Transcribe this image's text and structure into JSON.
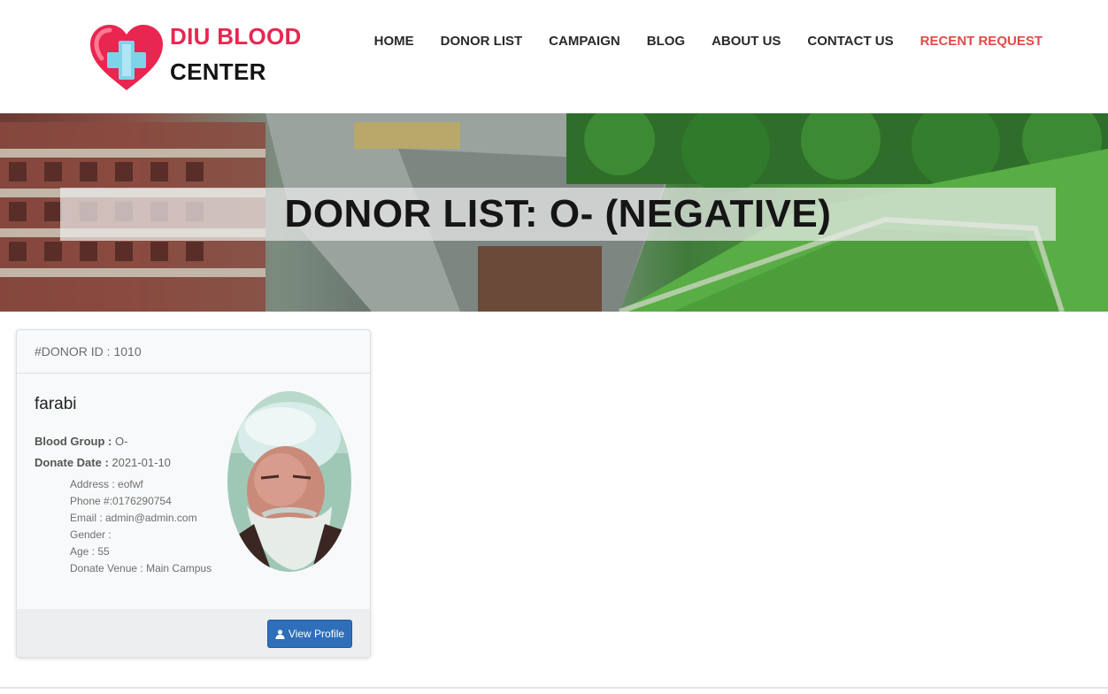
{
  "brand": {
    "line1": "DIU BLOOD",
    "line2": "CENTER",
    "logo_icon": "heart-plus-icon",
    "color_primary": "#e8264f"
  },
  "nav": {
    "items": [
      {
        "label": "HOME"
      },
      {
        "label": "DONOR LIST"
      },
      {
        "label": "CAMPAIGN"
      },
      {
        "label": "BLOG"
      },
      {
        "label": "ABOUT US"
      },
      {
        "label": "CONTACT US"
      },
      {
        "label": "RECENT REQUEST",
        "color": "#e14a4a"
      }
    ]
  },
  "banner": {
    "title": "DONOR LIST: O- (NEGATIVE)"
  },
  "donor": {
    "id_label": "#DONOR ID : 1010",
    "name": "farabi",
    "blood_group_label": "Blood Group :",
    "blood_group": " O-",
    "donate_date_label": "Donate Date :",
    "donate_date": " 2021-01-10",
    "address": "Address : eofwf",
    "phone": "Phone #:0176290754",
    "email": "Email : admin@admin.com",
    "gender": "Gender :",
    "age": "Age : 55",
    "venue": "Donate Venue : Main Campus",
    "view_profile_label": "View Profile",
    "view_profile_icon": "user-icon",
    "button_color": "#2f6fba"
  }
}
